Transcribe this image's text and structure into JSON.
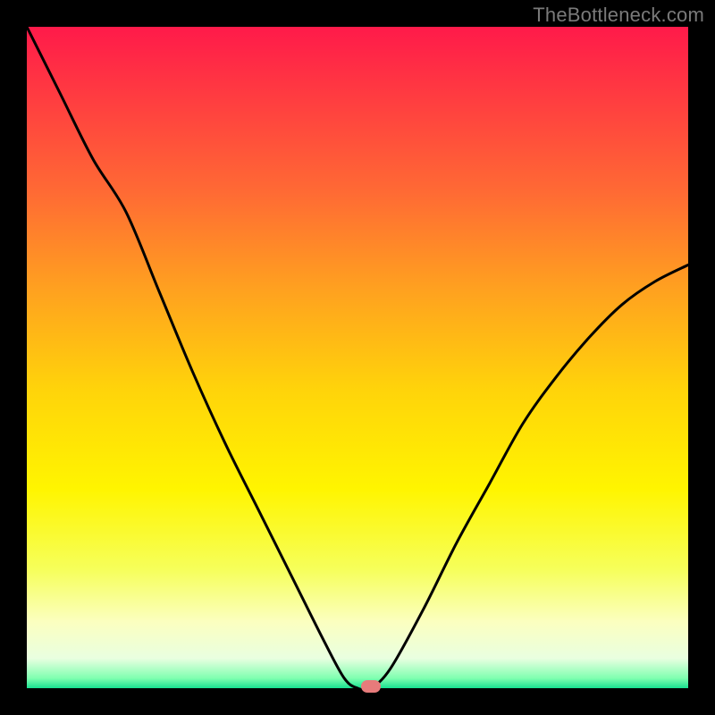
{
  "watermark": "TheBottleneck.com",
  "colors": {
    "frame_bg": "#000000",
    "watermark": "#7a7a7a",
    "curve": "#000000",
    "marker": "#e77b7b",
    "gradient_stops": [
      {
        "offset": 0.0,
        "color": "#ff1a4a"
      },
      {
        "offset": 0.1,
        "color": "#ff3a41"
      },
      {
        "offset": 0.25,
        "color": "#ff6a34"
      },
      {
        "offset": 0.4,
        "color": "#ffa21f"
      },
      {
        "offset": 0.55,
        "color": "#ffd40a"
      },
      {
        "offset": 0.7,
        "color": "#fff500"
      },
      {
        "offset": 0.82,
        "color": "#f6ff5a"
      },
      {
        "offset": 0.9,
        "color": "#fbffc0"
      },
      {
        "offset": 0.955,
        "color": "#e9ffe0"
      },
      {
        "offset": 0.985,
        "color": "#7fffb0"
      },
      {
        "offset": 1.0,
        "color": "#18e090"
      }
    ]
  },
  "chart_data": {
    "type": "line",
    "title": "",
    "xlabel": "",
    "ylabel": "",
    "x": [
      0.0,
      0.05,
      0.1,
      0.15,
      0.2,
      0.25,
      0.3,
      0.35,
      0.4,
      0.45,
      0.48,
      0.5,
      0.52,
      0.55,
      0.6,
      0.65,
      0.7,
      0.75,
      0.8,
      0.85,
      0.9,
      0.95,
      1.0
    ],
    "values": [
      1.0,
      0.9,
      0.8,
      0.72,
      0.6,
      0.48,
      0.37,
      0.27,
      0.17,
      0.07,
      0.015,
      0.0,
      0.0,
      0.03,
      0.12,
      0.22,
      0.31,
      0.4,
      0.47,
      0.53,
      0.58,
      0.615,
      0.64
    ],
    "xlim": [
      0,
      1
    ],
    "ylim": [
      0,
      1
    ],
    "marker": {
      "x": 0.52,
      "y": 0.0
    }
  }
}
